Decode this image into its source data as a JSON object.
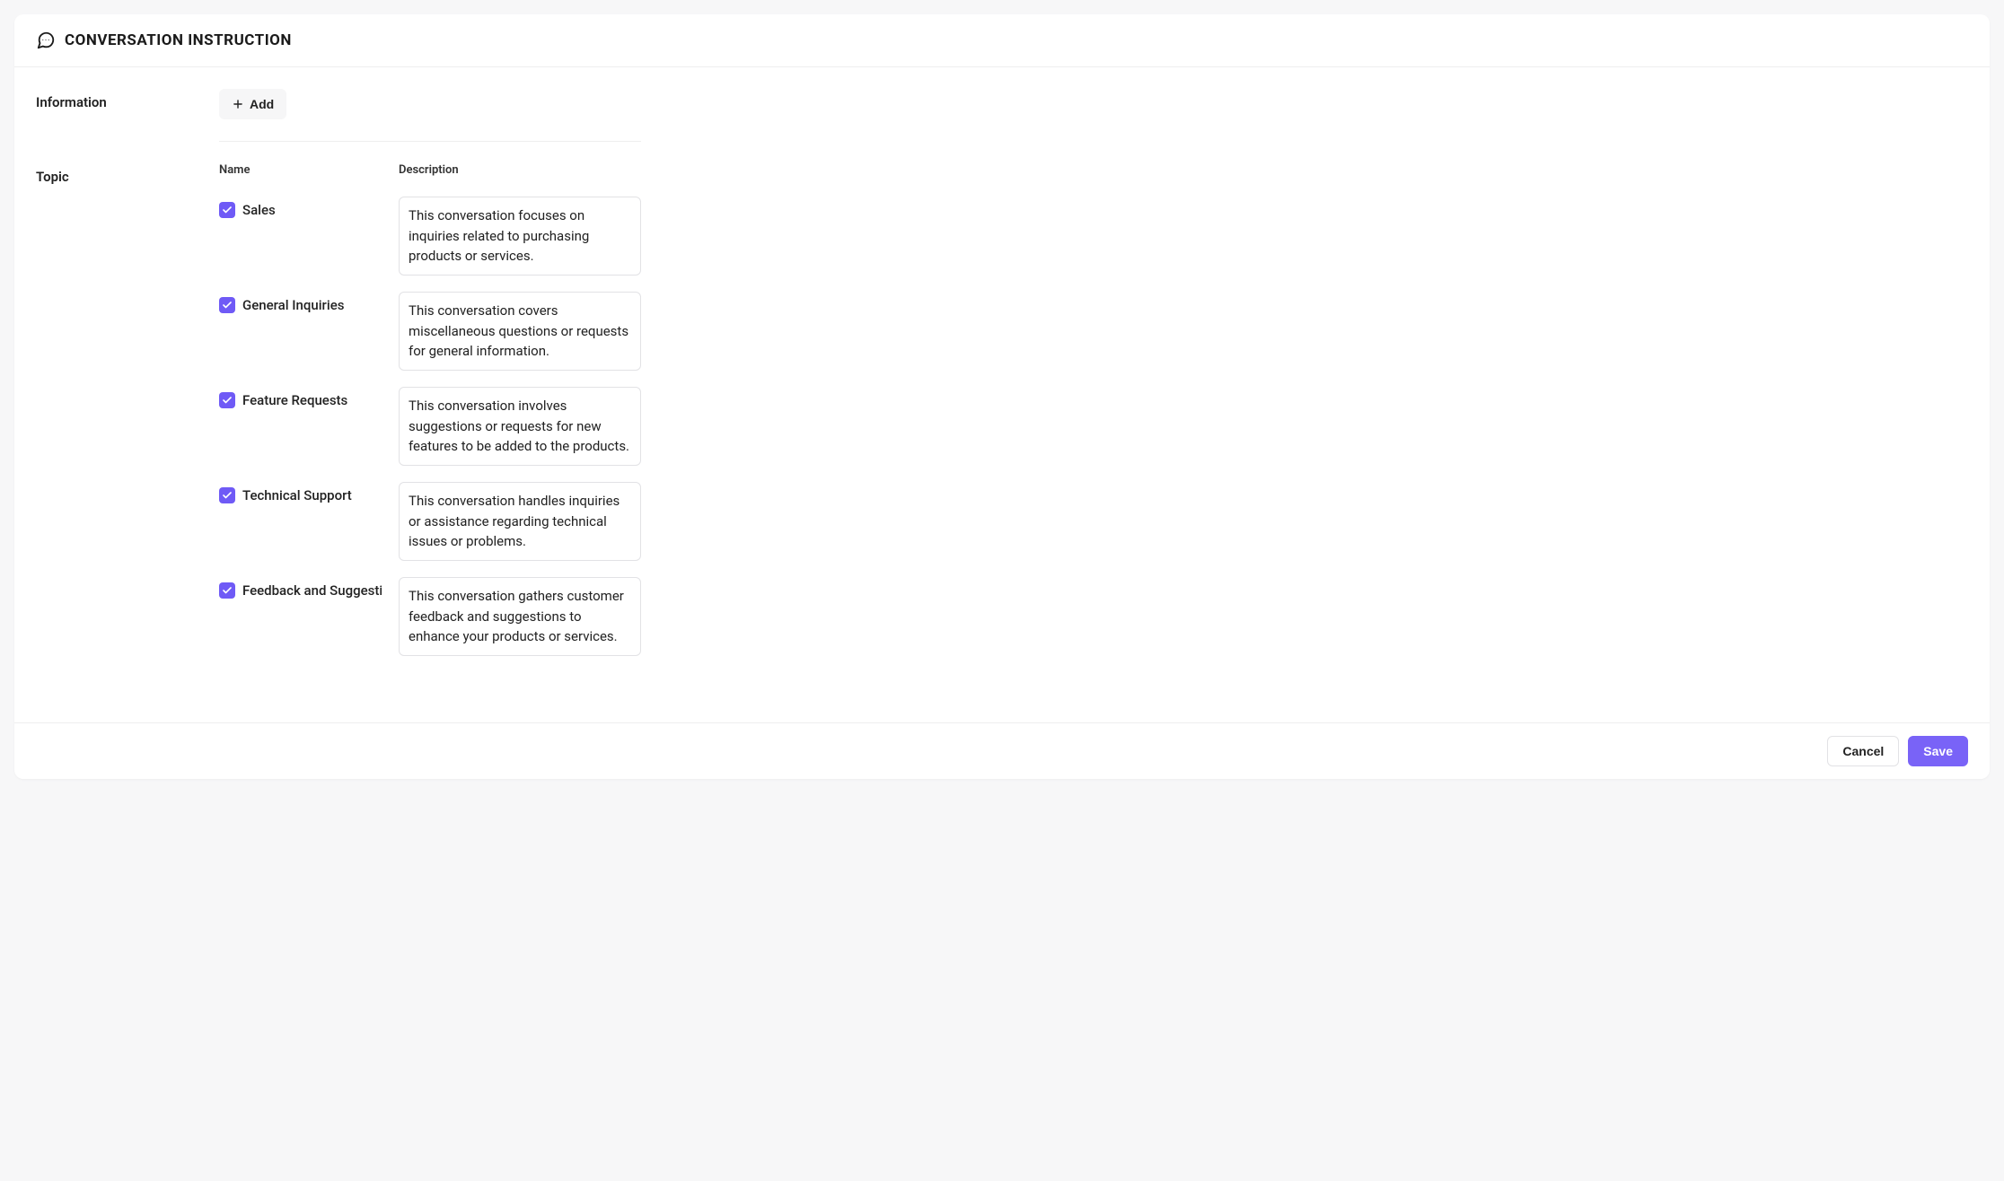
{
  "header": {
    "title": "CONVERSATION INSTRUCTION"
  },
  "information": {
    "label": "Information",
    "add_label": "Add"
  },
  "topic": {
    "label": "Topic",
    "columns": {
      "name": "Name",
      "description": "Description"
    },
    "rows": [
      {
        "checked": true,
        "name": "Sales",
        "description": "This conversation focuses on inquiries related to purchasing products or services."
      },
      {
        "checked": true,
        "name": "General Inquiries",
        "description": "This conversation covers miscellaneous questions or requests for general information."
      },
      {
        "checked": true,
        "name": "Feature Requests",
        "description": "This conversation involves suggestions or requests for new features to be added to the products."
      },
      {
        "checked": true,
        "name": "Technical Support",
        "description": "This conversation handles inquiries or assistance regarding technical issues or problems."
      },
      {
        "checked": true,
        "name": "Feedback and Suggestions",
        "description": "This conversation gathers customer feedback and suggestions to enhance your products or services."
      }
    ]
  },
  "footer": {
    "cancel_label": "Cancel",
    "save_label": "Save"
  },
  "colors": {
    "accent": "#6f5af6"
  }
}
